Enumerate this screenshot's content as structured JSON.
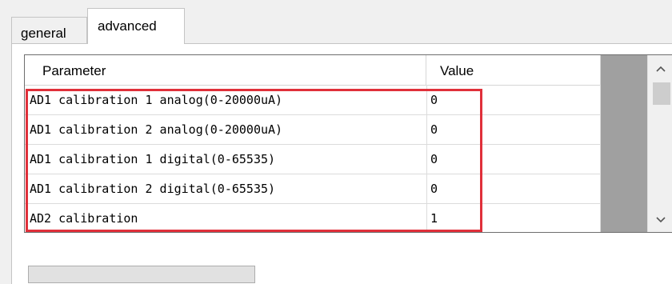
{
  "tabs": [
    {
      "label": "general"
    },
    {
      "label": "advanced"
    }
  ],
  "table": {
    "headers": [
      "Parameter",
      "Value"
    ],
    "rows": [
      {
        "param": "AD1 calibration 1 analog(0-20000uA)",
        "value": "0"
      },
      {
        "param": "AD1 calibration 2 analog(0-20000uA)",
        "value": "0"
      },
      {
        "param": "AD1 calibration 1 digital(0-65535)",
        "value": "0"
      },
      {
        "param": "AD1 calibration 2 digital(0-65535)",
        "value": "0"
      },
      {
        "param": "AD2 calibration",
        "value": "1"
      }
    ]
  },
  "scrollbar": {
    "up_icon": "chevron-up-icon",
    "down_icon": "chevron-down-icon"
  },
  "highlight": {
    "color": "#e0303a"
  }
}
